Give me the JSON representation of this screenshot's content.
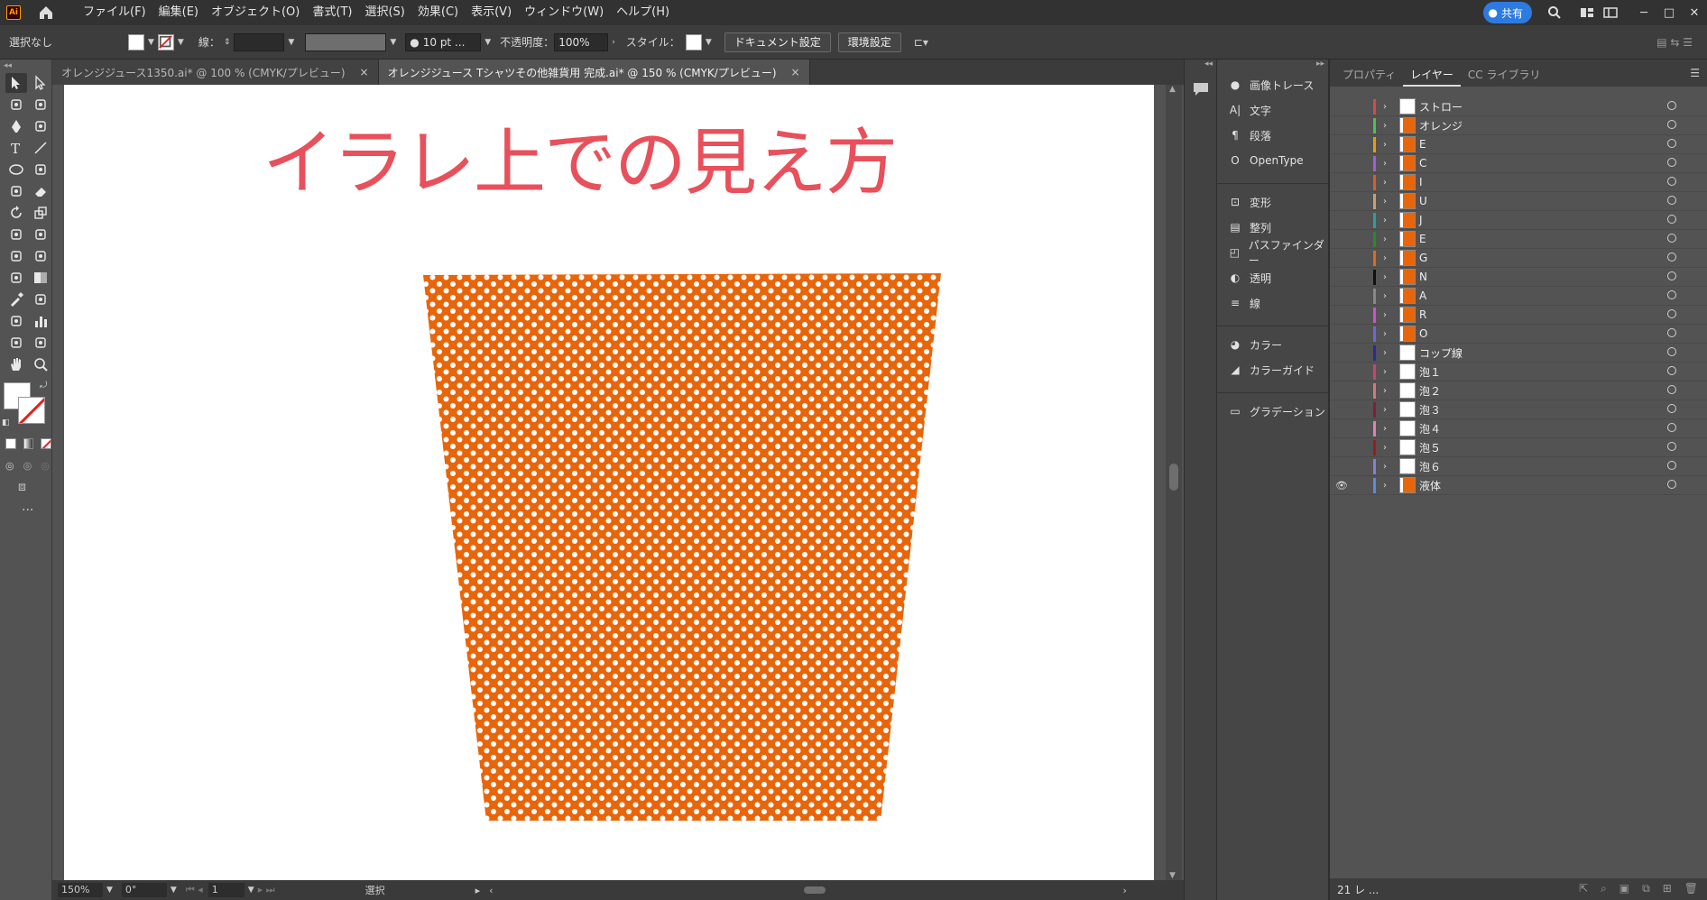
{
  "menubar": {
    "logo": "Ai",
    "items": [
      "ファイル(F)",
      "編集(E)",
      "オブジェクト(O)",
      "書式(T)",
      "選択(S)",
      "効果(C)",
      "表示(V)",
      "ウィンドウ(W)",
      "ヘルプ(H)"
    ],
    "share_label": "共有"
  },
  "control": {
    "selection": "選択なし",
    "stroke_label": "線：",
    "brush": "10 pt ...",
    "opacity_label": "不透明度：",
    "opacity": "100%",
    "style_label": "スタイル：",
    "doc_setup": "ドキュメント設定",
    "prefs": "環境設定"
  },
  "tabs": [
    {
      "label": "オレンジジュース1350.ai* @ 100 % (CMYK/プレビュー)",
      "close": "×"
    },
    {
      "label": "オレンジジュース Tシャツその他雑貨用 完成.ai* @ 150 % (CMYK/プレビュー)",
      "close": "×"
    }
  ],
  "artboard": {
    "heading": "イラレ上での見え方",
    "heading_color": "#e8505b",
    "cup_color": "#e8650a",
    "dot_color": "#ffffff"
  },
  "status": {
    "zoom": "150%",
    "rotate": "0°",
    "page": "1",
    "mode": "選択"
  },
  "panels": [
    {
      "label": "画像トレース",
      "icon": "image-trace-icon"
    },
    {
      "label": "文字",
      "icon": "character-icon"
    },
    {
      "label": "段落",
      "icon": "paragraph-icon"
    },
    {
      "label": "OpenType",
      "icon": "opentype-icon"
    },
    {
      "label": "変形",
      "icon": "transform-icon"
    },
    {
      "label": "整列",
      "icon": "align-icon"
    },
    {
      "label": "パスファインダー",
      "icon": "pathfinder-icon"
    },
    {
      "label": "透明",
      "icon": "transparency-icon"
    },
    {
      "label": "線",
      "icon": "stroke-icon"
    },
    {
      "label": "カラー",
      "icon": "color-icon"
    },
    {
      "label": "カラーガイド",
      "icon": "color-guide-icon"
    },
    {
      "label": "グラデーション",
      "icon": "gradient-icon"
    }
  ],
  "layers_panel": {
    "tabs": [
      "プロパティ",
      "レイヤー",
      "CC ライブラリ"
    ],
    "active_tab": 1,
    "footer_count": "21 レ ...",
    "layers": [
      {
        "name": "ストロー",
        "color": "#e04545",
        "thumb": "white",
        "visible": false
      },
      {
        "name": "オレンジ",
        "color": "#4fc14f",
        "thumb": "orange",
        "visible": false
      },
      {
        "name": "E",
        "color": "#e8a000",
        "thumb": "orange",
        "visible": false
      },
      {
        "name": "C",
        "color": "#a45cd8",
        "thumb": "orange",
        "visible": false
      },
      {
        "name": "I",
        "color": "#e05a2a",
        "thumb": "orange",
        "visible": false
      },
      {
        "name": "U",
        "color": "#c8a070",
        "thumb": "orange",
        "visible": false
      },
      {
        "name": "J",
        "color": "#2aa0a0",
        "thumb": "orange",
        "visible": false
      },
      {
        "name": "E",
        "color": "#2a8a2a",
        "thumb": "orange",
        "visible": false
      },
      {
        "name": "G",
        "color": "#e06a1a",
        "thumb": "orange",
        "visible": false
      },
      {
        "name": "N",
        "color": "#111111",
        "thumb": "orange",
        "visible": false
      },
      {
        "name": "A",
        "color": "#888888",
        "thumb": "orange",
        "visible": false
      },
      {
        "name": "R",
        "color": "#d050d0",
        "thumb": "orange",
        "visible": false
      },
      {
        "name": "O",
        "color": "#6a6ad8",
        "thumb": "orange",
        "visible": false
      },
      {
        "name": "コップ線",
        "color": "#2a2a9a",
        "thumb": "white",
        "visible": false
      },
      {
        "name": "泡１",
        "color": "#d04070",
        "thumb": "white",
        "visible": false
      },
      {
        "name": "泡２",
        "color": "#e07080",
        "thumb": "white",
        "visible": false
      },
      {
        "name": "泡３",
        "color": "#8a1a3a",
        "thumb": "white",
        "visible": false
      },
      {
        "name": "泡４",
        "color": "#e080b0",
        "thumb": "white",
        "visible": false
      },
      {
        "name": "泡５",
        "color": "#a01a1a",
        "thumb": "white",
        "visible": false
      },
      {
        "name": "泡６",
        "color": "#8080e0",
        "thumb": "white",
        "visible": false
      },
      {
        "name": "液体",
        "color": "#5a8ae0",
        "thumb": "orange",
        "visible": true
      }
    ]
  }
}
